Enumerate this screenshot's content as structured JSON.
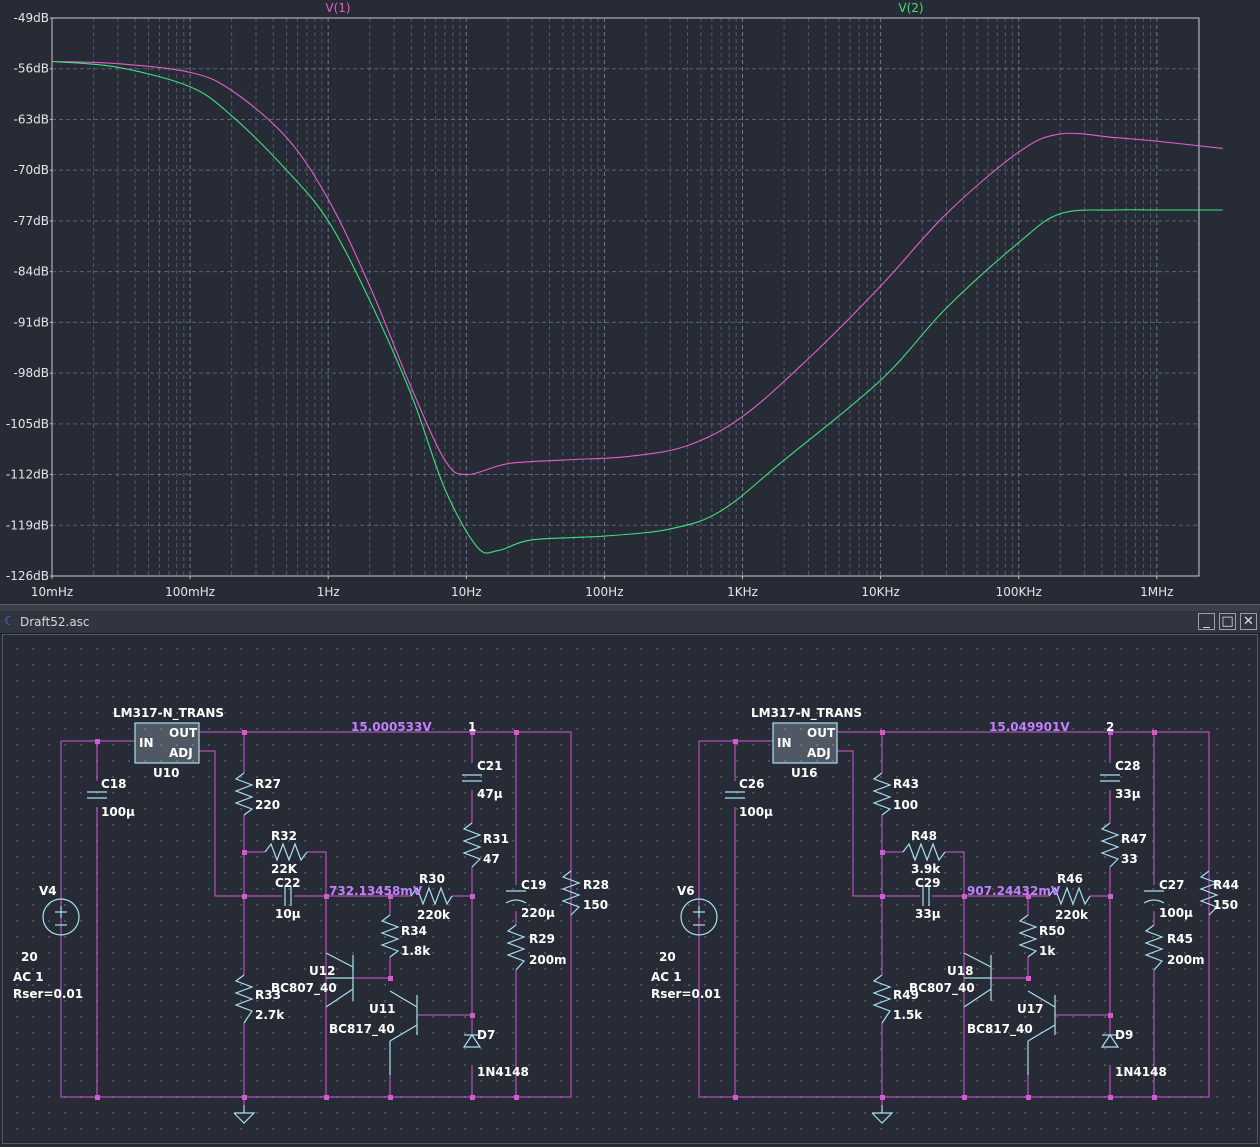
{
  "plot": {
    "trace_labels": [
      {
        "name": "V(1)",
        "color": "#e060c8"
      },
      {
        "name": "V(2)",
        "color": "#40e080"
      }
    ],
    "y_ticks": [
      "-49dB",
      "-56dB",
      "-63dB",
      "-70dB",
      "-77dB",
      "-84dB",
      "-91dB",
      "-98dB",
      "-105dB",
      "-112dB",
      "-119dB",
      "-126dB"
    ],
    "x_ticks": [
      "10mHz",
      "100mHz",
      "1Hz",
      "10Hz",
      "100Hz",
      "1KHz",
      "10KHz",
      "100KHz",
      "1MHz"
    ]
  },
  "chart_data": {
    "type": "line",
    "x_scale": "log",
    "xlim": [
      0.01,
      3000000
    ],
    "ylim": [
      -126,
      -49
    ],
    "grid": true,
    "series": [
      {
        "name": "V(1)",
        "color": "#e060c8",
        "points": [
          [
            0.01,
            -55
          ],
          [
            0.03,
            -55.3
          ],
          [
            0.1,
            -56.5
          ],
          [
            0.2,
            -59
          ],
          [
            0.5,
            -65.5
          ],
          [
            1,
            -74
          ],
          [
            2,
            -86
          ],
          [
            4,
            -100
          ],
          [
            7,
            -110
          ],
          [
            10,
            -112
          ],
          [
            20,
            -110.5
          ],
          [
            50,
            -110
          ],
          [
            150,
            -109.5
          ],
          [
            400,
            -108
          ],
          [
            1000,
            -104
          ],
          [
            3000,
            -96
          ],
          [
            10000,
            -86
          ],
          [
            30000,
            -76
          ],
          [
            100000,
            -67.5
          ],
          [
            200000,
            -65
          ],
          [
            500000,
            -65.5
          ],
          [
            1000000,
            -66
          ],
          [
            3000000,
            -67
          ]
        ]
      },
      {
        "name": "V(2)",
        "color": "#40e080",
        "points": [
          [
            0.01,
            -55
          ],
          [
            0.03,
            -55.8
          ],
          [
            0.1,
            -58.5
          ],
          [
            0.2,
            -62.5
          ],
          [
            0.5,
            -70
          ],
          [
            1,
            -77
          ],
          [
            2,
            -88
          ],
          [
            4,
            -101
          ],
          [
            7,
            -114
          ],
          [
            12,
            -122
          ],
          [
            17,
            -122.5
          ],
          [
            30,
            -121
          ],
          [
            100,
            -120.5
          ],
          [
            300,
            -119.5
          ],
          [
            700,
            -117
          ],
          [
            2000,
            -110
          ],
          [
            10000,
            -99
          ],
          [
            30000,
            -89
          ],
          [
            100000,
            -80
          ],
          [
            200000,
            -76
          ],
          [
            500000,
            -75.5
          ],
          [
            1000000,
            -75.5
          ],
          [
            3000000,
            -75.5
          ]
        ]
      }
    ]
  },
  "window": {
    "title": "Draft52.asc",
    "minimize": "_",
    "maximize": "□",
    "close": "✕",
    "icon": "ltspice-app-icon"
  },
  "schematic": {
    "left": {
      "regulator": {
        "type": "LM317-N_TRANS",
        "ref": "U10",
        "pin_in": "IN",
        "pin_out": "OUT",
        "pin_adj": "ADJ"
      },
      "out_voltage": "15.000533V",
      "node": "1",
      "mid_voltage": "732.13458mV",
      "source": {
        "ref": "V4",
        "value": "20",
        "ac": "AC 1",
        "rser": "Rser=0.01"
      },
      "c_in": {
        "ref": "C18",
        "value": "100µ"
      },
      "r_top": {
        "ref": "R27",
        "value": "220"
      },
      "r_fb": {
        "ref": "R32",
        "value": "22K"
      },
      "c_fb": {
        "ref": "C22",
        "value": "10µ"
      },
      "r_bot": {
        "ref": "R33",
        "value": "2.7k"
      },
      "r_b": {
        "ref": "R30",
        "value": "220k"
      },
      "r_e": {
        "ref": "R34",
        "value": "1.8k"
      },
      "q1": {
        "ref": "U12",
        "model": "BC807_40"
      },
      "q2": {
        "ref": "U11",
        "model": "BC817_40"
      },
      "c_out1": {
        "ref": "C21",
        "value": "47µ"
      },
      "r_out1": {
        "ref": "R31",
        "value": "47"
      },
      "diode": {
        "ref": "D7",
        "model": "1N4148"
      },
      "c_out2": {
        "ref": "C19",
        "value": "220µ"
      },
      "r_esr": {
        "ref": "R29",
        "value": "200m"
      },
      "r_load": {
        "ref": "R28",
        "value": "150"
      }
    },
    "right": {
      "regulator": {
        "type": "LM317-N_TRANS",
        "ref": "U16",
        "pin_in": "IN",
        "pin_out": "OUT",
        "pin_adj": "ADJ"
      },
      "out_voltage": "15.049901V",
      "node": "2",
      "mid_voltage": "907.24432mV",
      "source": {
        "ref": "V6",
        "value": "20",
        "ac": "AC 1",
        "rser": "Rser=0.01"
      },
      "c_in": {
        "ref": "C26",
        "value": "100µ"
      },
      "r_top": {
        "ref": "R43",
        "value": "100"
      },
      "r_fb": {
        "ref": "R48",
        "value": "3.9k"
      },
      "c_fb": {
        "ref": "C29",
        "value": "33µ"
      },
      "r_bot": {
        "ref": "R49",
        "value": "1.5k"
      },
      "r_b": {
        "ref": "R46",
        "value": "220k"
      },
      "r_e": {
        "ref": "R50",
        "value": "1k"
      },
      "q1": {
        "ref": "U18",
        "model": "BC807_40"
      },
      "q2": {
        "ref": "U17",
        "model": "BC817_40"
      },
      "c_out1": {
        "ref": "C28",
        "value": "33µ"
      },
      "r_out1": {
        "ref": "R47",
        "value": "33"
      },
      "diode": {
        "ref": "D9",
        "model": "1N4148"
      },
      "c_out2": {
        "ref": "C27",
        "value": "100µ"
      },
      "r_esr": {
        "ref": "R45",
        "value": "200m"
      },
      "r_load": {
        "ref": "R44",
        "value": "150"
      }
    }
  }
}
